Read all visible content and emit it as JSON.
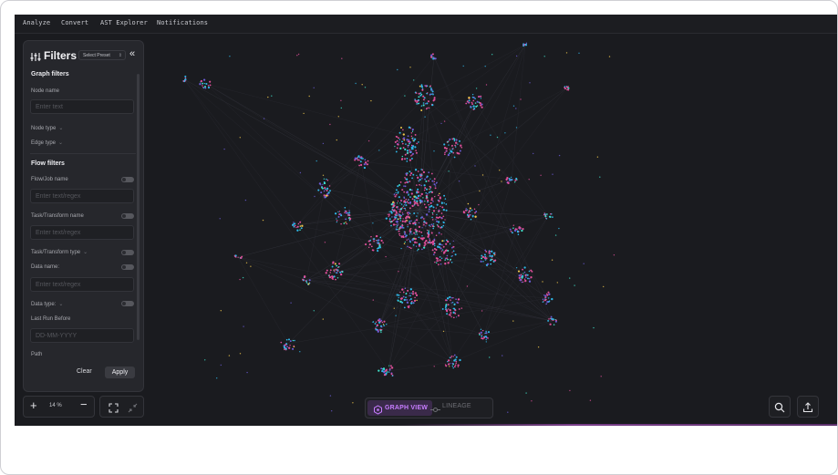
{
  "menu": [
    "Analyze",
    "Convert",
    "AST Explorer",
    "Notifications"
  ],
  "filters": {
    "title": "Filters",
    "preset_label": "Select Preset",
    "graph_section": "Graph filters",
    "node_name_label": "Node name",
    "node_name_placeholder": "Enter text",
    "node_type_label": "Node type",
    "edge_type_label": "Edge type",
    "flow_section": "Flow filters",
    "flow_job_label": "Flow/Job name",
    "flow_job_placeholder": "Enter text/regex",
    "task_name_label": "Task/Transform name",
    "task_name_placeholder": "Enter text/regex",
    "task_type_label": "Task/Transform type",
    "data_name_label": "Data name:",
    "data_name_placeholder": "Enter text/regex",
    "data_type_label": "Data type:",
    "last_run_label": "Last Run Before",
    "last_run_placeholder": "DD-MM-YYYY",
    "path_label": "Path",
    "clear_label": "Clear",
    "apply_label": "Apply"
  },
  "zoom": {
    "value": "14 %",
    "plus": "+",
    "minus": "−"
  },
  "views": {
    "graph": "GRAPH VIEW",
    "lineage": "LINEAGE"
  },
  "colors": {
    "background": "#1a1b1f",
    "panel": "#26272c",
    "accent": "#c77dff",
    "node_colors": [
      "#e04f9a",
      "#2fb7e8",
      "#6c5bd6",
      "#3fe0c8",
      "#f2c94c"
    ]
  },
  "icons": {
    "filter": "sliders-icon",
    "collapse": "chevrons-left-icon",
    "fit": "fit-screen-icon",
    "shrink": "shrink-icon",
    "graph_view": "graph-view-icon",
    "lineage": "lineage-icon",
    "search": "search-icon",
    "export": "upload-icon"
  }
}
